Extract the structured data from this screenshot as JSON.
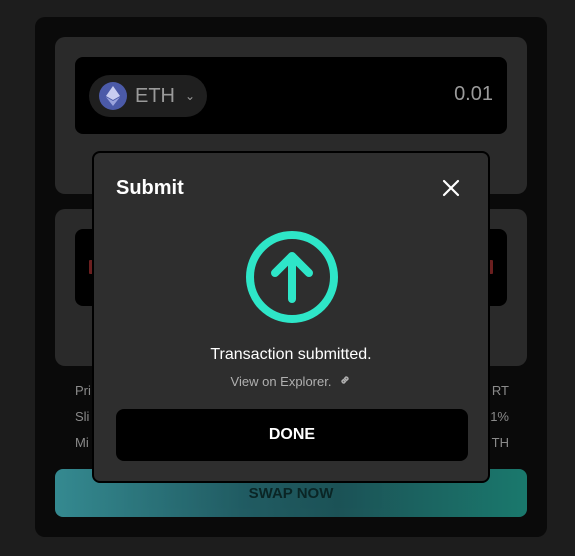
{
  "swap": {
    "from_token": {
      "symbol": "ETH",
      "icon": "eth-icon",
      "amount": "0.01"
    },
    "swap_label": "SWAP NOW",
    "info_rows": [
      {
        "left": "Pri",
        "right": "RT"
      },
      {
        "left": "Sli",
        "right": "1%"
      },
      {
        "left": "Mi",
        "right": "TH"
      }
    ]
  },
  "modal": {
    "title": "Submit",
    "close_icon": "close-icon",
    "status_icon": "arrow-up-circle-icon",
    "status_text": "Transaction submitted.",
    "explorer_label": "View on Explorer.",
    "explorer_icon": "link-icon",
    "done_label": "DONE"
  },
  "colors": {
    "accent": "#2ee6c8",
    "modal_bg": "#2e2e2e",
    "page_bg": "#1d1d1d"
  }
}
